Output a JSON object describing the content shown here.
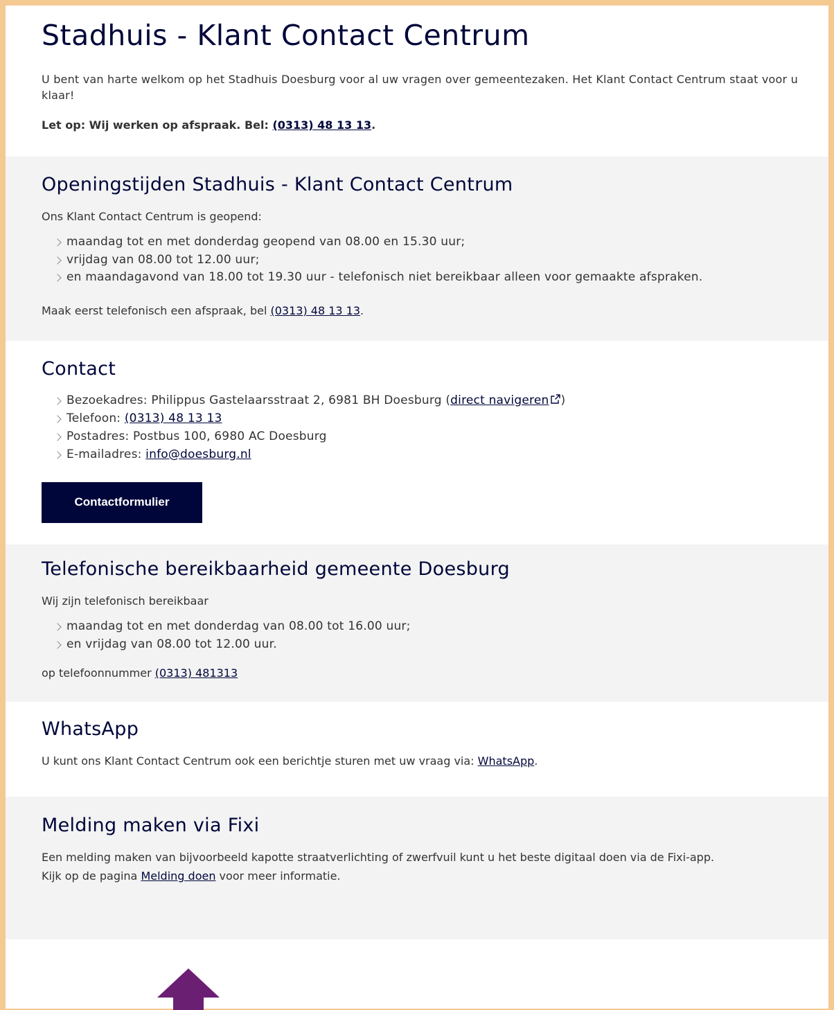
{
  "header": {
    "title": "Stadhuis - Klant Contact Centrum",
    "intro": "U bent van harte welkom op het Stadhuis Doesburg voor al uw vragen over gemeentezaken. Het Klant Contact Centrum staat voor u klaar!",
    "notice_label": "Let op: Wij werken op afspraak. Bel: ",
    "notice_phone": "(0313) 48 13 13",
    "notice_end": "."
  },
  "opening": {
    "title": "Openingstijden Stadhuis - Klant Contact Centrum",
    "intro": "Ons Klant Contact Centrum is geopend:",
    "items": [
      "maandag tot en met donderdag geopend van 08.00 en 15.30 uur;",
      "vrijdag van 08.00 tot 12.00 uur;",
      "en maandagavond van 18.00 tot 19.30 uur - telefonisch niet bereikbaar alleen voor gemaakte afspraken."
    ],
    "footer_text": "Maak eerst telefonisch een afspraak, bel ",
    "footer_phone": "(0313) 48 13 13",
    "footer_end": "."
  },
  "contact": {
    "title": "Contact",
    "visit_label": "Bezoekadres: Philippus Gastelaarsstraat 2, 6981 BH Doesburg (",
    "visit_link": "direct navigeren",
    "visit_end": ")",
    "phone_label": "Telefoon: ",
    "phone_link": "(0313) 48 13 13",
    "postal": "Postadres: Postbus 100, 6980 AC Doesburg",
    "email_label": "E-mailadres: ",
    "email_link": "info@doesburg.nl",
    "button_label": "Contactformulier"
  },
  "phone_hours": {
    "title": "Telefonische bereikbaarheid gemeente Doesburg",
    "intro": "Wij zijn telefonisch bereikbaar",
    "items": [
      "maandag tot en met donderdag van 08.00 tot 16.00 uur;",
      "en vrijdag van 08.00 tot 12.00 uur."
    ],
    "footer_text": "op telefoonnummer ",
    "footer_phone": "(0313) 481313"
  },
  "whatsapp": {
    "title": "WhatsApp",
    "text": "U kunt ons Klant Contact Centrum ook een berichtje sturen met uw vraag via: ",
    "link": "WhatsApp",
    "end": "."
  },
  "fixi": {
    "title": "Melding maken via Fixi",
    "text1": "Een melding maken van bijvoorbeeld kapotte straatverlichting of zwerfvuil kunt u het beste digitaal doen via de Fixi-app.",
    "text2_before": "Kijk op de pagina ",
    "text2_link": "Melding doen",
    "text2_after": " voor meer informatie."
  },
  "icons": {
    "external": "external-link-icon",
    "arrow": "up-arrow-annotation-icon",
    "arrow_color": "#6b1f73",
    "frame_color": "#f5c992",
    "brand_color": "#00063a"
  }
}
